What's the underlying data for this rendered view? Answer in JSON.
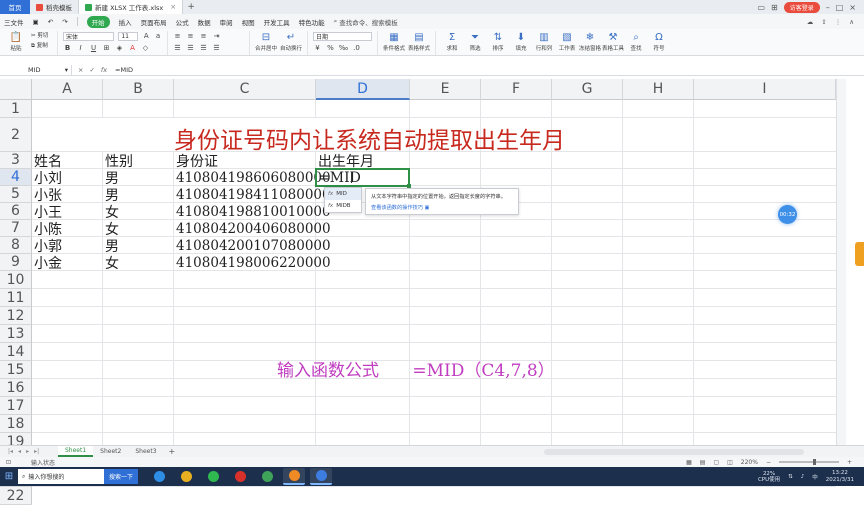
{
  "titlebar": {
    "home": "首页",
    "tabs": [
      {
        "label": "稻壳模板",
        "color": "#e94b3c"
      },
      {
        "label": "新建 XLSX 工作表.xlsx",
        "color": "#2fa84f"
      }
    ],
    "login": "访客登录"
  },
  "menubar": {
    "file": "三文件",
    "items": [
      "开始",
      "插入",
      "页面布局",
      "公式",
      "数据",
      "审阅",
      "视图",
      "开发工具",
      "特色功能"
    ],
    "active": "开始",
    "search": "查找命令、搜索模板"
  },
  "ribbon": {
    "paste": "粘贴",
    "cut": "剪切",
    "copy": "复制",
    "format_painter": "格式刷",
    "font_name": "宋体",
    "font_size": "11",
    "merge": "合并居中",
    "wrap": "自动换行",
    "number_format": "日期",
    "cond_format": "条件格式",
    "table_style": "表格样式",
    "sum": "求和",
    "filter": "筛选",
    "sort": "排序",
    "fill": "填充",
    "row_col": "行和列",
    "worksheet": "工作表",
    "freeze": "冻结窗格",
    "table_tools": "表格工具",
    "find": "查找",
    "symbol": "符号"
  },
  "formula_bar": {
    "name_box": "MID",
    "formula": "=MID"
  },
  "columns": [
    "A",
    "B",
    "C",
    "D",
    "E",
    "F",
    "G",
    "H",
    "I"
  ],
  "selected_column": "D",
  "rows": [
    "1",
    "2",
    "3",
    "4",
    "5",
    "6",
    "7",
    "8",
    "9",
    "10",
    "11",
    "12",
    "13",
    "14",
    "15",
    "16",
    "17",
    "18",
    "19",
    "20",
    "21",
    "22"
  ],
  "selected_row": "4",
  "sheet": {
    "title": "身份证号码内让系统自动提取出生年月",
    "headers": [
      "姓名",
      "性别",
      "身份证",
      "出生年月"
    ],
    "records": [
      {
        "name": "小刘",
        "gender": "男",
        "id": "410804198606080000"
      },
      {
        "name": "小张",
        "gender": "男",
        "id": "410804198411080000"
      },
      {
        "name": "小王",
        "gender": "女",
        "id": "410804198810010000"
      },
      {
        "name": "小陈",
        "gender": "女",
        "id": "410804200406080000"
      },
      {
        "name": "小郭",
        "gender": "男",
        "id": "410804200107080000"
      },
      {
        "name": "小金",
        "gender": "女",
        "id": "410804198006220000"
      }
    ],
    "active_cell_text": "=MID"
  },
  "autocomplete": {
    "items": [
      "MID",
      "MIDB"
    ],
    "tip": "从文本字符串中指定的位置开始，返回指定长度的字符串。",
    "tip_link": "查看该函数的操作技巧"
  },
  "annotation": {
    "label": "输入函数公式",
    "formula": "=MID（C4,7,8）"
  },
  "timer_badge": "00:32",
  "sheet_tabs": [
    "Sheet1",
    "Sheet2",
    "Sheet3"
  ],
  "active_sheet": "Sheet1",
  "status": {
    "mode": "输入状态",
    "zoom": "220%"
  },
  "taskbar": {
    "search_placeholder": "输入你想搜的",
    "search_button": "搜索一下",
    "cpu_percent": "22%",
    "cpu_label": "CPU使用",
    "time": "13:22",
    "date": "2021/3/31"
  }
}
